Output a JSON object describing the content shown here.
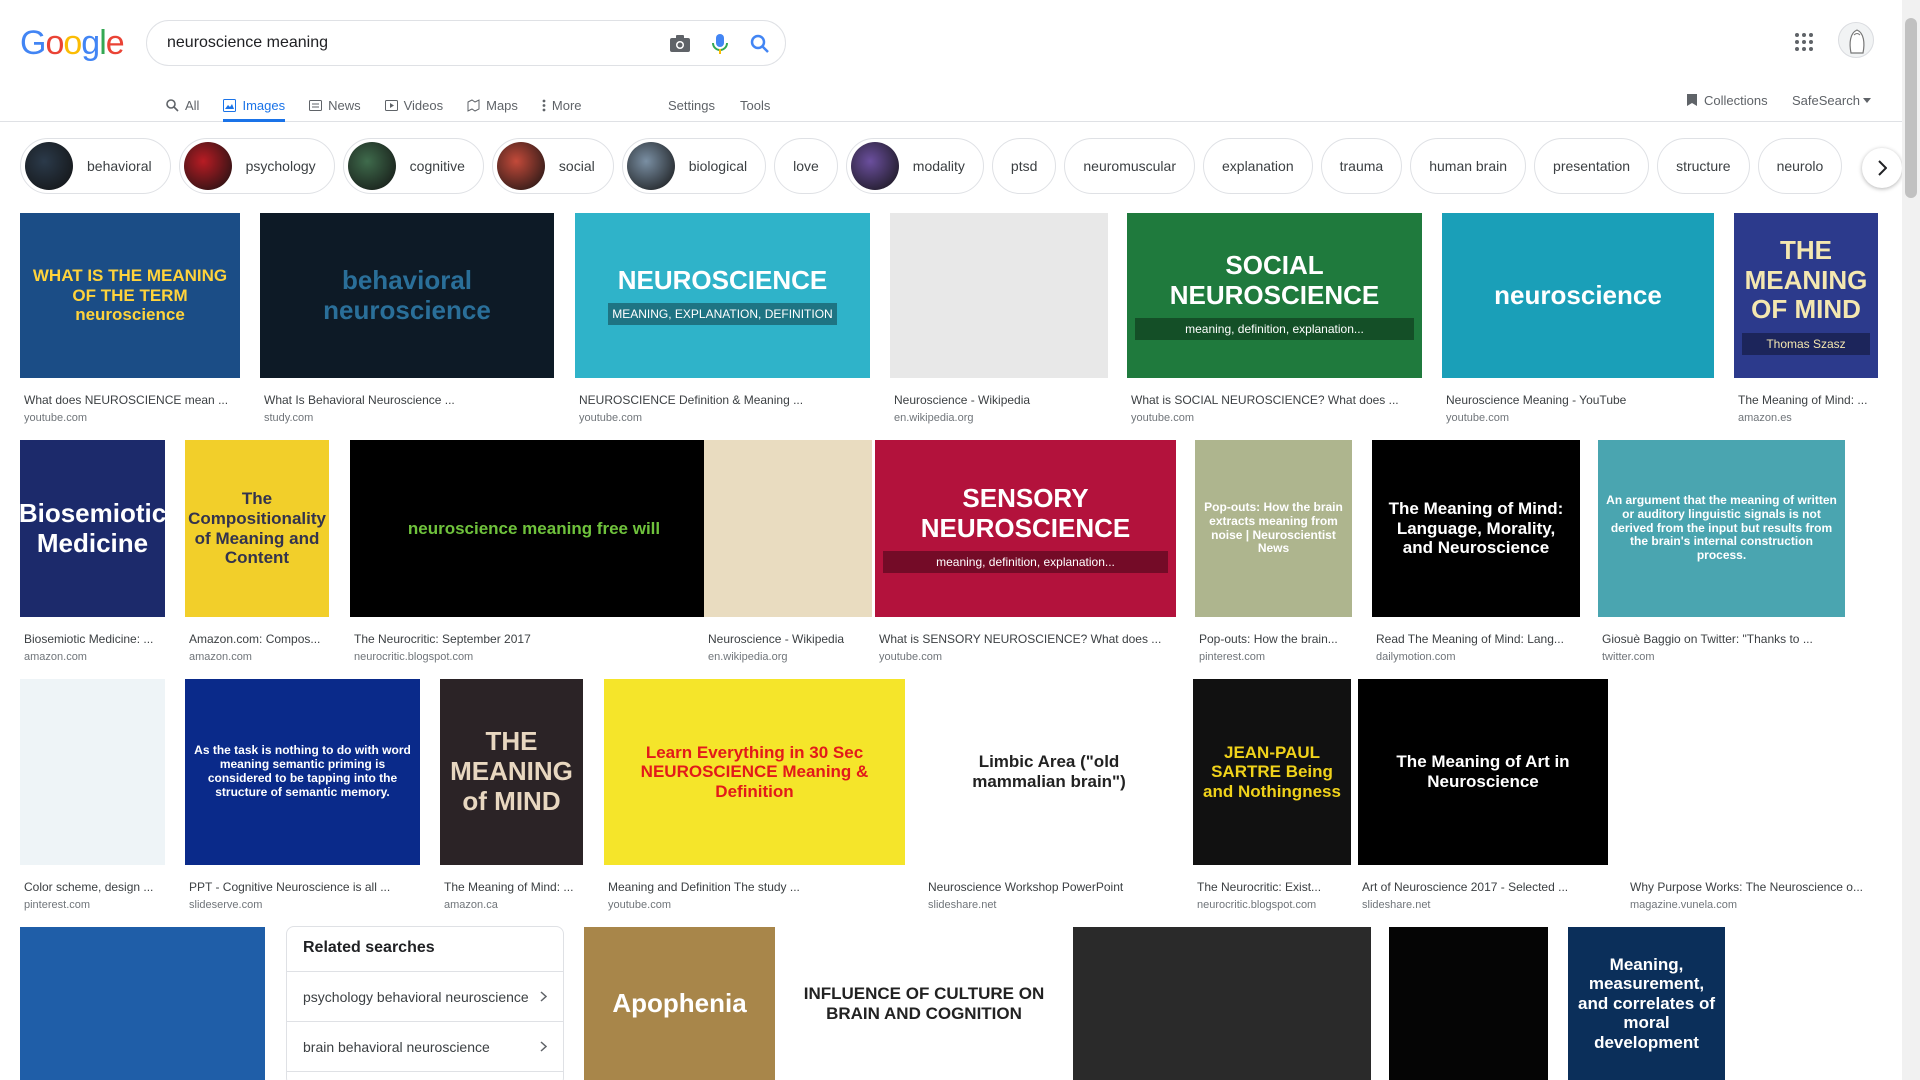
{
  "header": {
    "logo": [
      "G",
      "o",
      "o",
      "g",
      "l",
      "e"
    ],
    "logo_colors": [
      "#4285F4",
      "#EA4335",
      "#FBBC05",
      "#4285F4",
      "#34A853",
      "#EA4335"
    ],
    "search_value": "neuroscience meaning",
    "icons": [
      "camera-icon",
      "mic-icon",
      "search-icon",
      "apps-icon"
    ]
  },
  "tabs": [
    {
      "label": "All",
      "icon": "search-icon"
    },
    {
      "label": "Images",
      "icon": "image-icon",
      "active": true
    },
    {
      "label": "News",
      "icon": "news-icon"
    },
    {
      "label": "Videos",
      "icon": "video-icon"
    },
    {
      "label": "Maps",
      "icon": "map-icon"
    },
    {
      "label": "More",
      "icon": "more-icon"
    }
  ],
  "tools": {
    "settings": "Settings",
    "tools": "Tools",
    "collections": "Collections",
    "safesearch": "SafeSearch"
  },
  "chips": [
    {
      "label": "behavioral",
      "color": "#2b3a4a"
    },
    {
      "label": "psychology",
      "color": "#b81c24"
    },
    {
      "label": "cognitive",
      "color": "#3f6b4c"
    },
    {
      "label": "social",
      "color": "#c34a3a"
    },
    {
      "label": "biological",
      "color": "#7a8fa3"
    },
    {
      "label": "love"
    },
    {
      "label": "modality",
      "color": "#6b4f9e"
    },
    {
      "label": "ptsd"
    },
    {
      "label": "neuromuscular"
    },
    {
      "label": "explanation"
    },
    {
      "label": "trauma"
    },
    {
      "label": "human brain"
    },
    {
      "label": "presentation"
    },
    {
      "label": "structure"
    },
    {
      "label": "neurolo"
    }
  ],
  "row1": [
    {
      "title": "What does NEUROSCIENCE mean ...",
      "source": "youtube.com",
      "img_text": "WHAT IS THE MEANING OF THE TERM neuroscience",
      "bg": "#1b4d86",
      "fg": "#ffd33b"
    },
    {
      "title": "What Is Behavioral Neuroscience ...",
      "source": "study.com",
      "img_text": "behavioral neuroscience",
      "bg": "#0d1a26",
      "fg": "#2a6f99"
    },
    {
      "title": "NEUROSCIENCE Definition & Meaning ...",
      "source": "youtube.com",
      "img_text": "NEUROSCIENCE",
      "sub": "MEANING, EXPLANATION, DEFINITION",
      "bg": "#2fb3c9",
      "fg": "#ffffff"
    },
    {
      "title": "Neuroscience - Wikipedia",
      "source": "en.wikipedia.org",
      "img_text": "",
      "bg": "#e8e8e8",
      "fg": "#333333"
    },
    {
      "title": "What is SOCIAL NEUROSCIENCE? What does ...",
      "source": "youtube.com",
      "img_text": "SOCIAL NEUROSCIENCE",
      "sub": "meaning, definition, explanation...",
      "bg": "#1f7a3d",
      "fg": "#ffffff"
    },
    {
      "title": "Neuroscience Meaning - YouTube",
      "source": "youtube.com",
      "img_text": "neuroscience",
      "bg": "#1a9fb8",
      "fg": "#ffffff"
    },
    {
      "title": "The Meaning of Mind: ...",
      "source": "amazon.es",
      "img_text": "THE MEANING OF MIND",
      "sub": "Thomas Szasz",
      "bg": "#2c3a8c",
      "fg": "#f4e7b0"
    }
  ],
  "row2": [
    {
      "title": "Biosemiotic Medicine: ...",
      "source": "amazon.com",
      "img_text": "Biosemiotic Medicine",
      "bg": "#1c2a6b",
      "fg": "#ffffff"
    },
    {
      "title": "Amazon.com: Compos...",
      "source": "amazon.com",
      "img_text": "The Compositionality of Meaning and Content",
      "bg": "#f2cf2a",
      "fg": "#33334d"
    },
    {
      "title": "The Neurocritic: September 2017",
      "source": "neurocritic.blogspot.com",
      "img_text": "neuroscience meaning free will",
      "bg": "#000000",
      "fg": "#6fc23c"
    },
    {
      "title": "Neuroscience - Wikipedia",
      "source": "en.wikipedia.org",
      "img_text": "",
      "bg": "#e9dcc0",
      "fg": "#333333"
    },
    {
      "title": "What is SENSORY NEUROSCIENCE? What does ...",
      "source": "youtube.com",
      "img_text": "SENSORY NEUROSCIENCE",
      "sub": "meaning, definition, explanation...",
      "bg": "#b3123c",
      "fg": "#ffffff"
    },
    {
      "title": "Pop-outs: How the brain...",
      "source": "pinterest.com",
      "img_text": "Pop-outs: How the brain extracts meaning from noise | Neuroscientist News",
      "bg": "#aeb58e",
      "fg": "#ffffff"
    },
    {
      "title": "Read The Meaning of Mind: Lang...",
      "source": "dailymotion.com",
      "img_text": "The Meaning of Mind: Language, Morality, and Neuroscience",
      "bg": "#000000",
      "fg": "#ffffff"
    },
    {
      "title": "Giosuè Baggio on Twitter: \"Thanks to ...",
      "source": "twitter.com",
      "img_text": "An argument that the meaning of written or auditory linguistic signals is not derived from the input but results from the brain's internal construction process.",
      "bg": "#4aa5b0",
      "fg": "#ffffff"
    }
  ],
  "row3": [
    {
      "title": "Color scheme, design ...",
      "source": "pinterest.com",
      "img_text": "",
      "bg": "#eef4f7",
      "fg": "#3a6d8c"
    },
    {
      "title": "PPT - Cognitive Neuroscience is all ...",
      "source": "slideserve.com",
      "img_text": "As the task is nothing to do with word meaning semantic priming is considered to be tapping into the structure of semantic memory.",
      "bg": "#0a2a8a",
      "fg": "#ffffff"
    },
    {
      "title": "The Meaning of Mind: ...",
      "source": "amazon.ca",
      "img_text": "THE MEANING of MIND",
      "bg": "#2b2326",
      "fg": "#e8d7c0"
    },
    {
      "title": "Meaning and Definition The study ...",
      "source": "youtube.com",
      "img_text": "Learn Everything in 30 Sec NEUROSCIENCE Meaning & Definition",
      "bg": "#f5e52a",
      "fg": "#e21a1a"
    },
    {
      "title": "Neuroscience Workshop PowerPoint",
      "source": "slideshare.net",
      "img_text": "Limbic Area (\"old mammalian brain\")",
      "bg": "#ffffff",
      "fg": "#222222"
    },
    {
      "title": "The Neurocritic: Exist...",
      "source": "neurocritic.blogspot.com",
      "img_text": "JEAN-PAUL SARTRE Being and Nothingness",
      "bg": "#111111",
      "fg": "#f0d21a"
    },
    {
      "title": "Art of Neuroscience 2017 - Selected ...",
      "source": "slideshare.net",
      "img_text": "The Meaning of Art in Neuroscience",
      "bg": "#000000",
      "fg": "#ffffff"
    },
    {
      "title": "Why Purpose Works: The Neuroscience o...",
      "source": "magazine.vunela.com",
      "img_text": "",
      "bg": "#ffffff",
      "fg": "#e23a3a"
    }
  ],
  "row4": [
    {
      "img_text": "",
      "bg": "#1f5ea8",
      "fg": "#8ac4ff"
    },
    {
      "img_text": "Apophenia",
      "bg": "#a8864a",
      "fg": "#ffffff"
    },
    {
      "img_text": "INFLUENCE OF CULTURE ON BRAIN AND COGNITION",
      "bg": "#ffffff",
      "fg": "#222222"
    },
    {
      "img_text": "",
      "bg": "#2a2a2a",
      "fg": "#dddddd"
    },
    {
      "img_text": "",
      "bg": "#050505",
      "fg": "#3adf3a"
    },
    {
      "img_text": "Meaning, measurement, and correlates of moral development",
      "bg": "#0b2f5a",
      "fg": "#ffffff"
    },
    {
      "img_text": "",
      "bg": "#ffffff",
      "fg": "#555555"
    }
  ],
  "related": {
    "heading": "Related searches",
    "items": [
      "psychology behavioral neuroscience",
      "brain behavioral neuroscience"
    ]
  }
}
